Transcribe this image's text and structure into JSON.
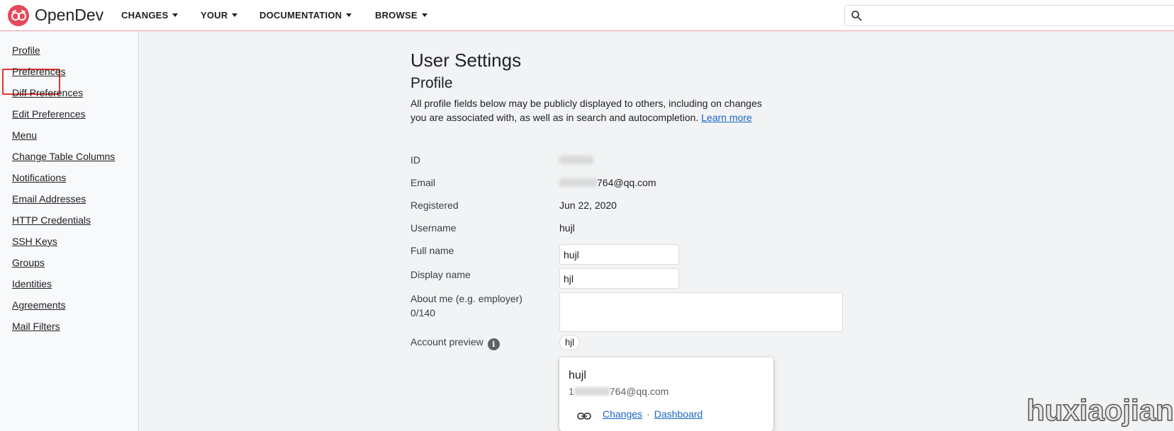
{
  "header": {
    "brand": "OpenDev",
    "nav": [
      {
        "label": "CHANGES"
      },
      {
        "label": "YOUR"
      },
      {
        "label": "DOCUMENTATION"
      },
      {
        "label": "BROWSE"
      }
    ],
    "search": {
      "value": "",
      "placeholder": ""
    }
  },
  "sidebar": {
    "items": [
      {
        "label": "Profile",
        "selected": true
      },
      {
        "label": "Preferences"
      },
      {
        "label": "Diff Preferences"
      },
      {
        "label": "Edit Preferences"
      },
      {
        "label": "Menu"
      },
      {
        "label": "Change Table Columns"
      },
      {
        "label": "Notifications"
      },
      {
        "label": "Email Addresses"
      },
      {
        "label": "HTTP Credentials"
      },
      {
        "label": "SSH Keys"
      },
      {
        "label": "Groups"
      },
      {
        "label": "Identities"
      },
      {
        "label": "Agreements"
      },
      {
        "label": "Mail Filters"
      }
    ]
  },
  "main": {
    "title": "User Settings",
    "section_title": "Profile",
    "description": "All profile fields below may be publicly displayed to others, including on changes you are associated with, as well as in search and autocompletion.",
    "learn_more": "Learn more",
    "fields": {
      "id_label": "ID",
      "email_label": "Email",
      "email_value": "764@qq.com",
      "registered_label": "Registered",
      "registered_value": "Jun 22, 2020",
      "username_label": "Username",
      "username_value": "hujl",
      "full_name_label": "Full name",
      "full_name_value": "hujl",
      "display_name_label": "Display name",
      "display_name_value": "hjl",
      "about_label": "About me (e.g. employer)",
      "about_count": "0/140",
      "about_value": "",
      "account_preview_label": "Account preview",
      "info_icon_glyph": "i"
    },
    "preview": {
      "chip": "hjl",
      "card_name": "hujl",
      "card_email_prefix": "1",
      "card_email_suffix": "764@qq.com",
      "changes_link": "Changes",
      "separator": "·",
      "dashboard_link": "Dashboard"
    }
  },
  "watermark": "huxiaojian",
  "colors": {
    "accent": "#1a66c3",
    "brand": "#e5495c",
    "highlight": "#e3342f"
  }
}
